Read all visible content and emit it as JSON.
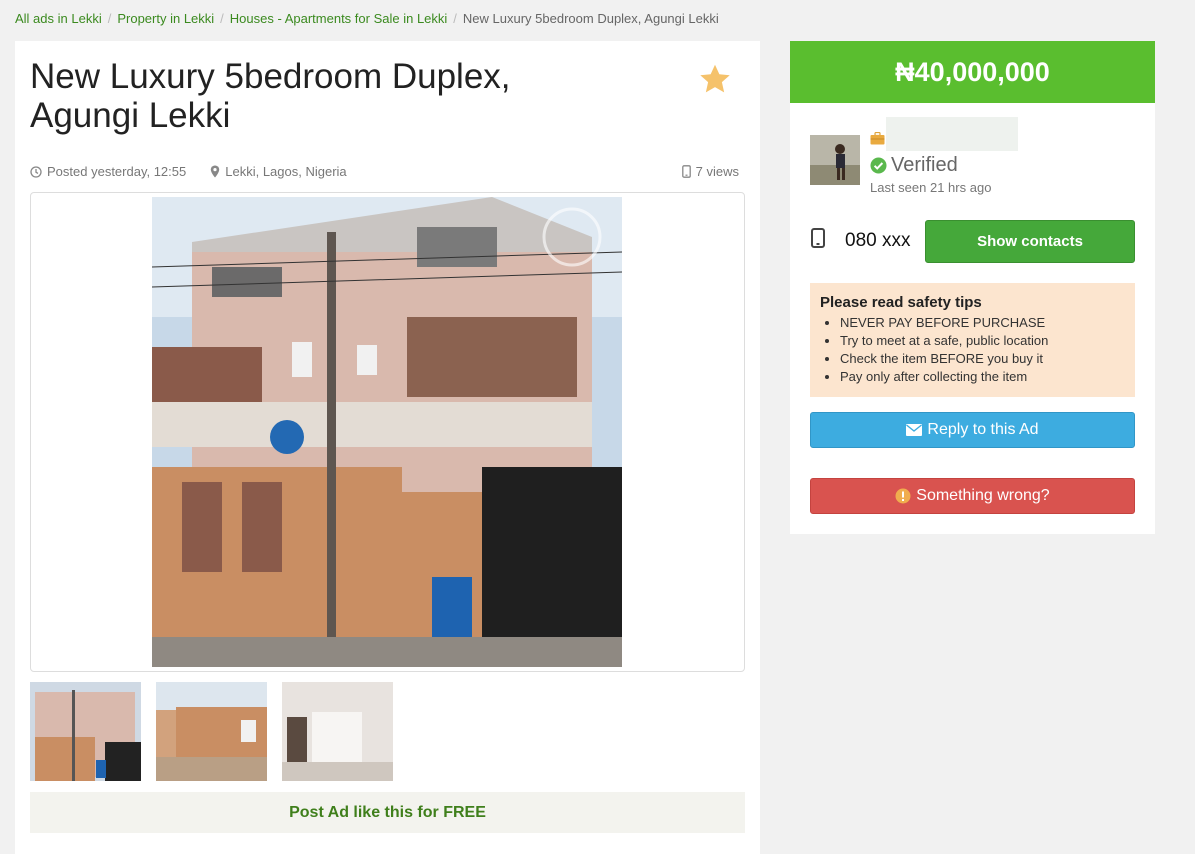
{
  "breadcrumb": {
    "items": [
      "All ads in Lekki",
      "Property in Lekki",
      "Houses - Apartments for Sale in Lekki"
    ],
    "current": "New Luxury 5bedroom Duplex, Agungi Lekki"
  },
  "ad": {
    "title": "New Luxury 5bedroom Duplex, Agungi Lekki",
    "posted": "Posted yesterday, 12:55",
    "location": "Lekki, Lagos, Nigeria",
    "views": "7 views",
    "post_free_label": "Post Ad like this for FREE"
  },
  "sidebar": {
    "price": "₦40,000,000",
    "seller_name": "",
    "verified_label": "Verified",
    "last_seen": "Last seen 21 hrs ago",
    "phone": "080 xxx",
    "show_contacts_label": "Show contacts",
    "safety": {
      "title": "Please read safety tips",
      "tips": [
        "NEVER PAY BEFORE PURCHASE",
        "Try to meet at a safe, public location",
        "Check the item BEFORE you buy it",
        "Pay only after collecting the item"
      ]
    },
    "reply_label": "Reply to this Ad",
    "wrong_label": "Something wrong?"
  },
  "colors": {
    "price_bar": "#5abe2f",
    "link": "#3b8a1f",
    "show_contacts": "#45a83a",
    "reply": "#3dace0",
    "wrong": "#d9534f",
    "safety_bg": "#fce5cf",
    "star": "#f5c26b"
  },
  "icons": [
    "star-icon",
    "clock-icon",
    "map-pin-icon",
    "mobile-icon",
    "briefcase-icon",
    "check-circle-icon",
    "envelope-icon",
    "exclamation-icon"
  ]
}
